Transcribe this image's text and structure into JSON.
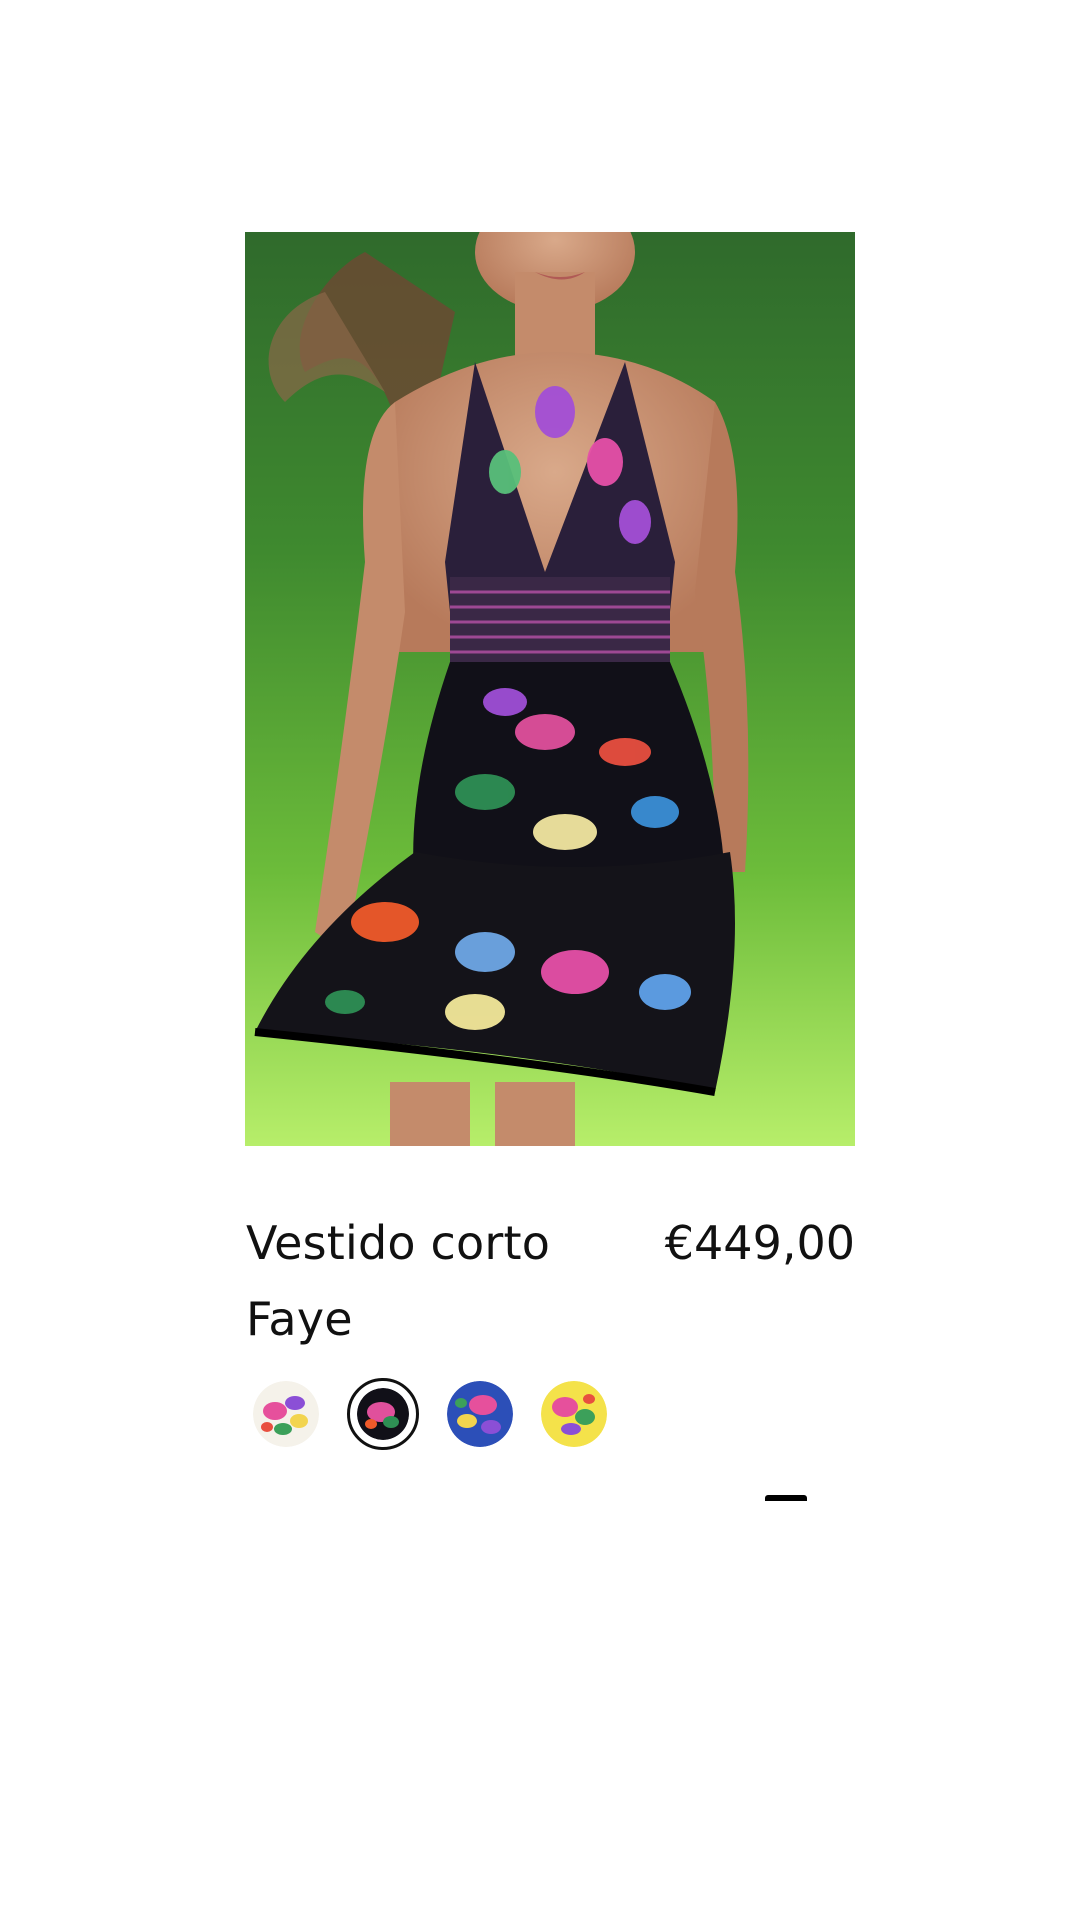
{
  "product": {
    "title": "Vestido corto Faye",
    "price": "€449,00",
    "image_alt": "Model wearing black floral butterfly print halter mini dress",
    "swatches": [
      {
        "name": "white-floral",
        "selected": false
      },
      {
        "name": "black-butterfly",
        "selected": true
      },
      {
        "name": "blue-butterfly",
        "selected": false
      },
      {
        "name": "yellow-floral",
        "selected": false
      }
    ]
  },
  "colors": {
    "background": "#ffffff",
    "text": "#111111"
  }
}
